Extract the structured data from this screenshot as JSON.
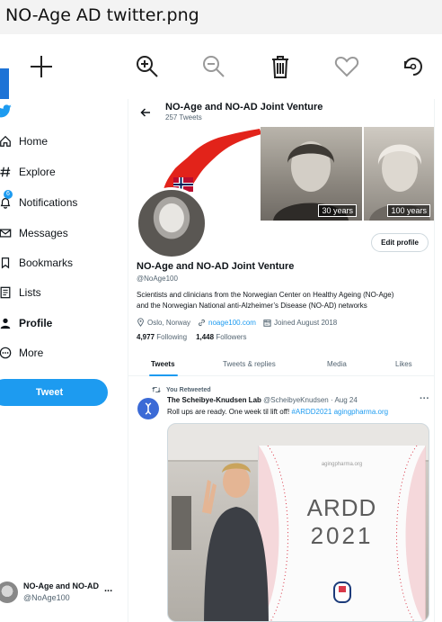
{
  "window": {
    "title": "NO-Age AD twitter.png"
  },
  "viewer_toolbar": {
    "zoom_in": "zoom-in-icon",
    "zoom_out": "zoom-out-icon",
    "delete": "trash-icon",
    "favorite": "heart-icon",
    "rotate": "rotate-icon"
  },
  "sidebar": {
    "items": [
      {
        "label": "Home",
        "icon": "home-icon"
      },
      {
        "label": "Explore",
        "icon": "hashtag-icon"
      },
      {
        "label": "Notifications",
        "icon": "bell-icon",
        "badge": "6"
      },
      {
        "label": "Messages",
        "icon": "envelope-icon"
      },
      {
        "label": "Bookmarks",
        "icon": "bookmark-icon"
      },
      {
        "label": "Lists",
        "icon": "list-icon"
      },
      {
        "label": "Profile",
        "icon": "person-icon",
        "active": true
      },
      {
        "label": "More",
        "icon": "more-icon"
      }
    ],
    "tweet_button": "Tweet",
    "account": {
      "name": "NO-Age and NO-AD",
      "handle": "@NoAge100",
      "menu": "..."
    }
  },
  "header": {
    "title": "NO-Age and NO-AD Joint Venture",
    "tweet_count": "257 Tweets"
  },
  "banner": {
    "tag1": "30 years",
    "tag2": "100 years"
  },
  "profile": {
    "edit_button": "Edit profile",
    "name": "NO-Age and NO-AD Joint Venture",
    "handle": "@NoAge100",
    "bio_line1": "Scientists and clinicians from  the Norwegian Center on Healthy Ageing (NO-Age)",
    "bio_line2": "and the Norwegian National anti-Alzheimer’s Disease (NO-AD) networks",
    "location": "Oslo, Norway",
    "website": "noage100.com",
    "joined": "Joined August 2018",
    "following_count": "4,977",
    "following_label": "Following",
    "followers_count": "1,448",
    "followers_label": "Followers"
  },
  "tabs": [
    "Tweets",
    "Tweets & replies",
    "Media",
    "Likes"
  ],
  "tweet": {
    "retweet_label": "You Retweeted",
    "author": "The Scheibye-Knudsen Lab",
    "author_handle": "@ScheibyeKnudsen",
    "date": "· Aug 24",
    "text": "Roll ups are ready. One week til lift off! ",
    "hashtag": "#ARDD2021",
    "link": "agingpharma.org",
    "menu": "···",
    "image": {
      "site_text": "agingpharma.org",
      "title": "ARDD",
      "year": "2021"
    }
  },
  "colors": {
    "accent": "#1d9bf0",
    "text": "#0f1419",
    "muted": "#536471",
    "twitter_blue": "#1d9bf0"
  }
}
